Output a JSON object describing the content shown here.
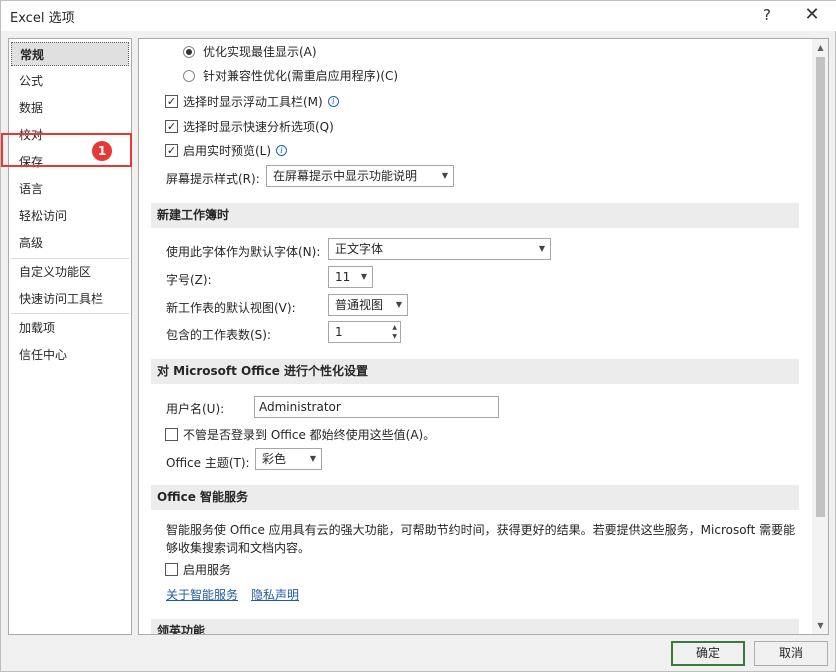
{
  "window": {
    "title": "Excel 选项",
    "help": "?",
    "close": "✕"
  },
  "nav": {
    "items": [
      {
        "label": "常规"
      },
      {
        "label": "公式"
      },
      {
        "label": "数据"
      },
      {
        "label": "校对"
      },
      {
        "label": "保存"
      },
      {
        "label": "语言"
      },
      {
        "label": "轻松访问"
      },
      {
        "label": "高级"
      },
      {
        "label": "自定义功能区"
      },
      {
        "label": "快速访问工具栏"
      },
      {
        "label": "加载项"
      },
      {
        "label": "信任中心"
      }
    ],
    "annotation_badge": "1"
  },
  "general": {
    "radio_optimize_display": "优化实现最佳显示(A)",
    "radio_compat": "针对兼容性优化(需重启应用程序)(C)",
    "chk_mini_toolbar": "选择时显示浮动工具栏(M)",
    "chk_quick_analysis": "选择时显示快速分析选项(Q)",
    "chk_live_preview": "启用实时预览(L)",
    "screentip_label": "屏幕提示样式(R):",
    "screentip_value": "在屏幕提示中显示功能说明"
  },
  "new_workbook": {
    "header": "新建工作簿时",
    "font_label": "使用此字体作为默认字体(N):",
    "font_value": "正文字体",
    "size_label": "字号(Z):",
    "size_value": "11",
    "view_label": "新工作表的默认视图(V):",
    "view_value": "普通视图",
    "sheets_label": "包含的工作表数(S):",
    "sheets_value": "1"
  },
  "personalize": {
    "header": "对 Microsoft Office 进行个性化设置",
    "username_label": "用户名(U):",
    "username_value": "Administrator",
    "chk_always_use": "不管是否登录到 Office 都始终使用这些值(A)。",
    "theme_label": "Office 主题(T):",
    "theme_value": "彩色"
  },
  "intelligent": {
    "header": "Office 智能服务",
    "description": "智能服务使 Office 应用具有云的强大功能，可帮助节约时间，获得更好的结果。若要提供这些服务，Microsoft 需要能够收集搜索词和文档内容。",
    "chk_enable": "启用服务",
    "link_about": "关于智能服务",
    "link_privacy": "隐私声明"
  },
  "linkedin": {
    "header": "领英功能"
  },
  "footer": {
    "ok": "确定",
    "cancel": "取消"
  }
}
